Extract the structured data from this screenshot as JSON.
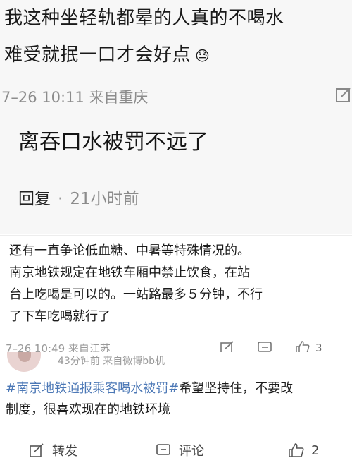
{
  "top_comment": {
    "line1": "我这种坐轻轨都晕的人真的不喝水",
    "line2": "难受就抿一口才会好点",
    "line2_emoji": "😓",
    "meta": "7–26 10:11  来自重庆",
    "reply_text": "离吞口水被罚不远了",
    "action_reply": "回复",
    "action_time": "21小时前"
  },
  "middle_comment": {
    "lines": [
      "还有一直争论低血糖、中暑等特殊情况的。",
      "南京地铁规定在地铁车厢中禁止饮食，在站",
      "台上吃喝是可以的。一站路最多５分钟，不行",
      "了下车吃喝就行了"
    ],
    "meta": "7–26 10:49  来自江苏",
    "like_count": "3"
  },
  "bottom_post": {
    "meta": "43分钟前  来自微博bb机",
    "topic": "#南京地铁通报乘客喝水被罚#",
    "text_after_topic": "希望坚持住，不要改",
    "line2": "制度，很喜欢现在的地铁环境",
    "repost_label": "转发",
    "comment_label": "评论",
    "like_count": "2"
  },
  "colors": {
    "topic": "#4c78b6",
    "meta": "#8c8c8c",
    "top_bg": "#f7f7f7"
  }
}
